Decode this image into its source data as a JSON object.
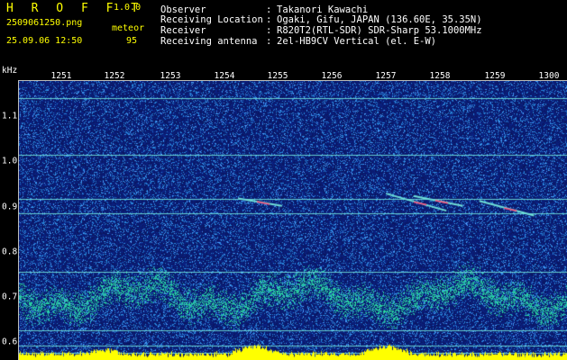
{
  "header": {
    "brand": "H R O F F T",
    "version": "1.0.0",
    "filename": "2509061250.png",
    "datetime": "25.09.06 12:50",
    "meteor_label": "meteor",
    "meteor_count": "95",
    "rows": [
      {
        "label": "Observer",
        "colon": ":",
        "value": "Takanori Kawachi"
      },
      {
        "label": "Receiving Location",
        "colon": ":",
        "value": "Ogaki, Gifu, JAPAN (136.60E, 35.35N)"
      },
      {
        "label": "Receiver",
        "colon": ":",
        "value": "R820T2(RTL-SDR) SDR-Sharp 53.1000MHz"
      },
      {
        "label": "Receiving antenna",
        "colon": ":",
        "value": "2el-HB9CV Vertical (el. E-W)"
      }
    ]
  },
  "chart_data": {
    "type": "heatmap",
    "ylabel": "kHz",
    "x_ticks": [
      "1251",
      "1252",
      "1253",
      "1254",
      "1255",
      "1256",
      "1257",
      "1258",
      "1259",
      "1300"
    ],
    "y_ticks": [
      "1.1",
      "1.0",
      "0.9",
      "0.8",
      "0.7",
      "0.6"
    ],
    "x_range": [
      "1250",
      "1300"
    ],
    "y_range": [
      0.59,
      1.16
    ],
    "grid": false,
    "carrier_lines_khz": [
      1.125,
      1.01,
      0.92,
      0.89,
      0.77,
      0.65,
      0.62,
      0.605
    ],
    "meteor_streaks": [
      {
        "x_start": 1254.0,
        "x_end": 1254.8,
        "khz_start": 0.92,
        "khz_end": 0.905
      },
      {
        "x_start": 1256.7,
        "x_end": 1257.8,
        "khz_start": 0.93,
        "khz_end": 0.895
      },
      {
        "x_start": 1257.2,
        "x_end": 1258.1,
        "khz_start": 0.925,
        "khz_end": 0.905
      },
      {
        "x_start": 1258.4,
        "x_end": 1259.4,
        "khz_start": 0.915,
        "khz_end": 0.885
      }
    ],
    "colors": {
      "background": "#0a1a7a",
      "noise_low": "#102aa0",
      "noise_high": "#3a6cff",
      "carrier": "#6fe0d8",
      "echo": "#ff4a7a",
      "bottom_band": "#ffff00",
      "header_accent": "#ffff00"
    }
  }
}
